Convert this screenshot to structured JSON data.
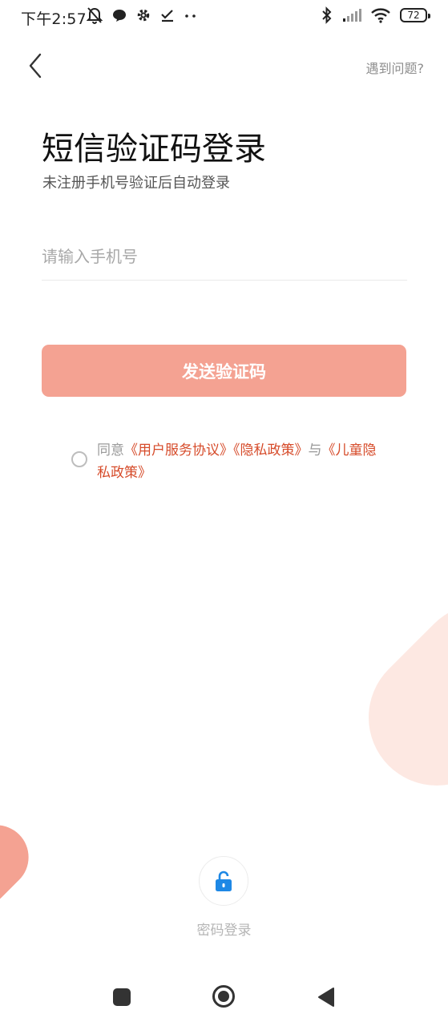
{
  "status_bar": {
    "time": "下午2:57",
    "battery": "72",
    "icons_left": [
      "mute-bell-icon",
      "chat-bubble-icon",
      "settings-gear-icon",
      "checkmark-icon",
      "more-dots-icon"
    ],
    "icons_right": [
      "bluetooth-icon",
      "signal-icon",
      "wifi-icon",
      "battery-icon"
    ]
  },
  "header": {
    "help_link": "遇到问题?"
  },
  "main": {
    "title": "短信验证码登录",
    "subtitle": "未注册手机号验证后自动登录",
    "phone_placeholder": "请输入手机号",
    "phone_value": "",
    "send_button": "发送验证码"
  },
  "agreement": {
    "prefix": "同意",
    "user_agreement": "《用户服务协议》",
    "privacy_policy": "《隐私政策》",
    "conjunction": "与",
    "child_privacy": "《儿童隐私政策》"
  },
  "password_login": {
    "label": "密码登录",
    "icon": "unlock-icon"
  },
  "colors": {
    "accent": "#f4a292",
    "link": "#d64b2a",
    "lock_blue": "#1e88e5",
    "blob_light": "#fde8e2"
  }
}
